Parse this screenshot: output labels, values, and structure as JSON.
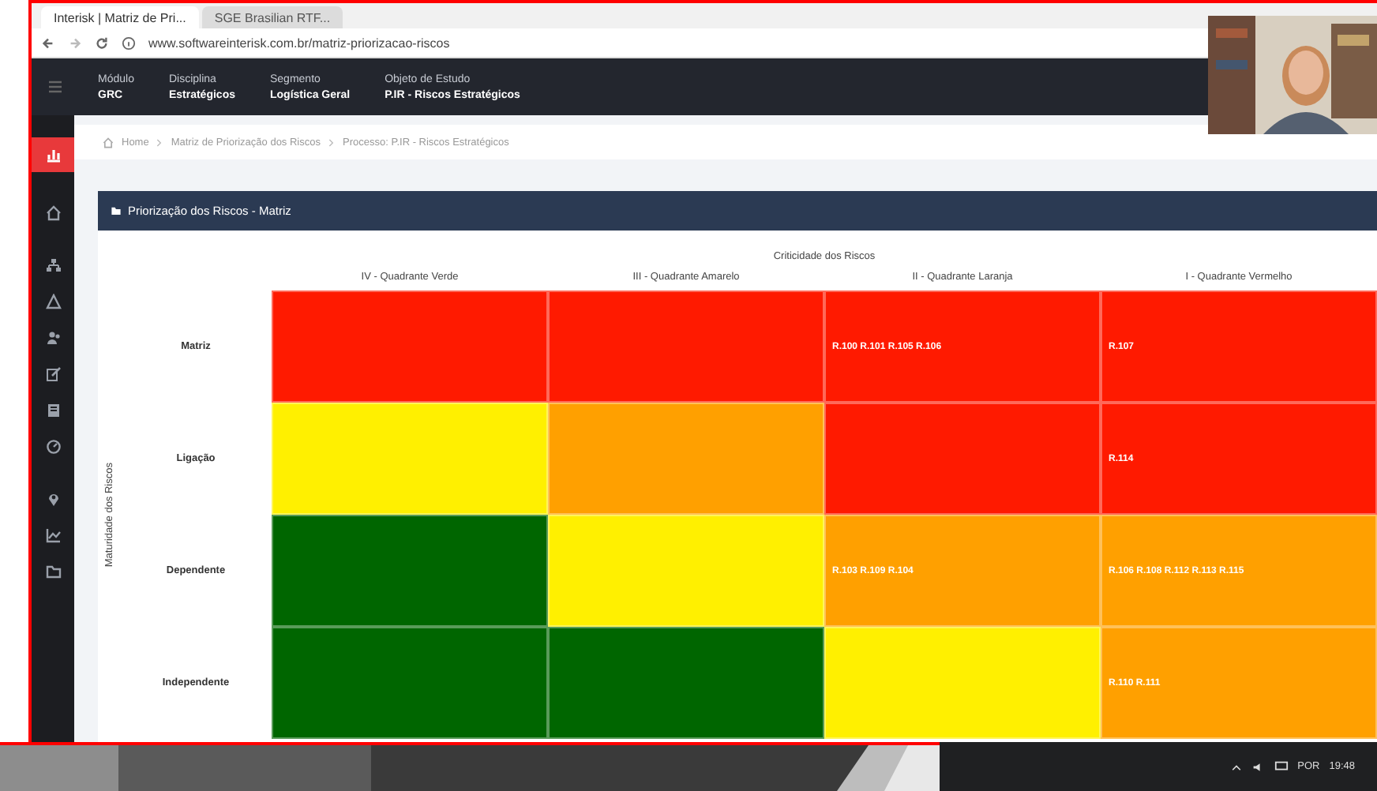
{
  "browser": {
    "tabs": [
      {
        "label": "Interisk | Matriz de Pri...",
        "selected": true
      },
      {
        "label": "SGE Brasilian RTF...",
        "selected": false
      }
    ],
    "url": "www.softwareinterisk.com.br/matriz-priorizacao-riscos"
  },
  "app_header": {
    "fields": [
      {
        "label": "Módulo",
        "value": "GRC"
      },
      {
        "label": "Disciplina",
        "value": "Estratégicos"
      },
      {
        "label": "Segmento",
        "value": "Logística Geral"
      },
      {
        "label": "Objeto de Estudo",
        "value": "P.IR - Riscos Estratégicos"
      }
    ]
  },
  "breadcrumb": [
    {
      "label": "Home"
    },
    {
      "label": "Matriz de Priorização dos Riscos"
    },
    {
      "label": "Processo: P.IR - Riscos Estratégicos"
    }
  ],
  "panel": {
    "title": "Priorização dos Riscos - Matriz",
    "x_title": "Criticidade dos Riscos",
    "y_title": "Maturidade dos Riscos",
    "columns": [
      "IV - Quadrante Verde",
      "III - Quadrante Amarelo",
      "II - Quadrante Laranja",
      "I - Quadrante Vermelho"
    ],
    "rows": [
      {
        "label": "Matriz",
        "cells": [
          {
            "color": "#ff1a00",
            "text": ""
          },
          {
            "color": "#ff1a00",
            "text": ""
          },
          {
            "color": "#ff1a00",
            "text": "R.100 R.101 R.105 R.106"
          },
          {
            "color": "#ff1a00",
            "text": "R.107"
          }
        ]
      },
      {
        "label": "Ligação",
        "cells": [
          {
            "color": "#fff000",
            "text": ""
          },
          {
            "color": "#ffa000",
            "text": ""
          },
          {
            "color": "#ff1a00",
            "text": ""
          },
          {
            "color": "#ff1a00",
            "text": "R.114"
          }
        ]
      },
      {
        "label": "Dependente",
        "cells": [
          {
            "color": "#006600",
            "text": ""
          },
          {
            "color": "#fff000",
            "text": ""
          },
          {
            "color": "#ffa000",
            "text": "R.103 R.109 R.104"
          },
          {
            "color": "#ffa000",
            "text": "R.106 R.108 R.112 R.113 R.115"
          }
        ]
      },
      {
        "label": "Independente",
        "cells": [
          {
            "color": "#006600",
            "text": ""
          },
          {
            "color": "#006600",
            "text": ""
          },
          {
            "color": "#fff000",
            "text": ""
          },
          {
            "color": "#ffa000",
            "text": "R.110 R.111"
          }
        ]
      }
    ]
  },
  "taskbar": {
    "language": "POR",
    "time": "19:48"
  }
}
